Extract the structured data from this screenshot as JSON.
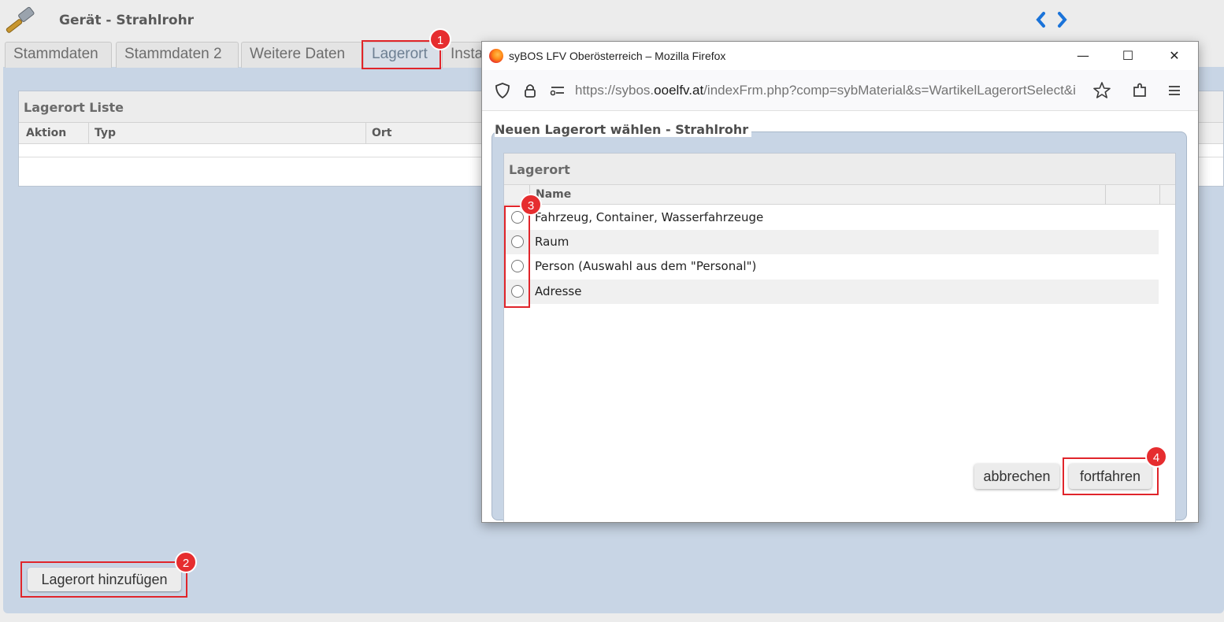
{
  "header": {
    "title": "Gerät - Strahlrohr",
    "app_icon": "hammer-icon",
    "nav_prev_icon": "chevron-left-icon",
    "nav_next_icon": "chevron-right-icon"
  },
  "tabs": [
    {
      "label": "Stammdaten",
      "active": false
    },
    {
      "label": "Stammdaten 2",
      "active": false
    },
    {
      "label": "Weitere Daten",
      "active": false
    },
    {
      "label": "Lagerort",
      "active": true
    },
    {
      "label": "Insta",
      "active": false
    }
  ],
  "lagerort_list": {
    "title": "Lagerort Liste",
    "columns": [
      "Aktion",
      "Typ",
      "Ort"
    ],
    "rows": []
  },
  "add_button_label": "Lagerort hinzufügen",
  "badges": [
    "1",
    "2",
    "3",
    "4"
  ],
  "browser_window": {
    "title": "syBOS LFV Oberösterreich – Mozilla Firefox",
    "url_prefix": "https://sybos.",
    "url_domain": "ooelfv.at",
    "url_rest": "/indexFrm.php?comp=sybMaterial&s=WartikelLagerortSelect&i",
    "controls": {
      "minimize": "—",
      "maximize": "☐",
      "close": "✕"
    }
  },
  "dialog": {
    "heading": "Neuen Lagerort wählen - Strahlrohr",
    "panel_title": "Lagerort",
    "column_name": "Name",
    "options": [
      "Fahrzeug, Container, Wasserfahrzeuge",
      "Raum",
      "Person (Auswahl aus dem \"Personal\")",
      "Adresse"
    ],
    "cancel_label": "abbrechen",
    "continue_label": "fortfahren"
  },
  "colors": {
    "highlight": "#e0252b",
    "badge": "#e62d2f",
    "panel_bg": "#c8d5e5",
    "nav_arrow": "#1a73d9"
  }
}
